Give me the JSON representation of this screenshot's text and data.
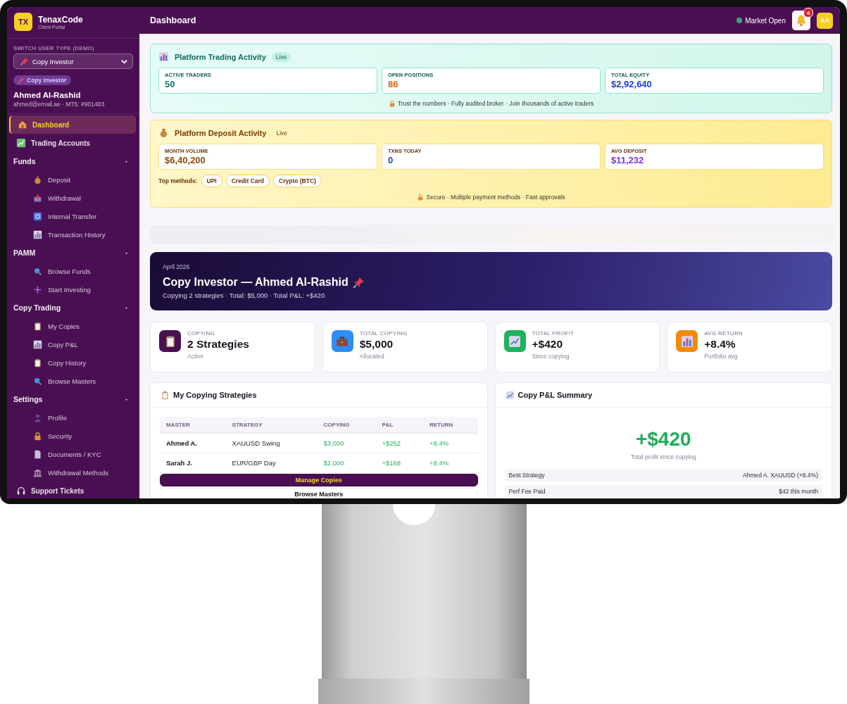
{
  "sidebar": {
    "logo": "TX",
    "brand": "TenaxCode",
    "brand_subtitle": "Client Portal",
    "switcher": {
      "label": "SWITCH USER TYPE (DEMO)",
      "value": "Copy Investor"
    },
    "role_badge": "Copy Investor",
    "user": {
      "name": "Ahmed Al-Rashid",
      "meta": "ahmed@email.ae · MT5: #901483"
    },
    "nav": [
      {
        "kind": "link",
        "label": "Dashboard",
        "selected": true
      },
      {
        "kind": "link",
        "label": "Trading Accounts",
        "selected": false
      },
      {
        "kind": "group",
        "label": "Funds",
        "expanded": true,
        "children": [
          {
            "label": "Deposit",
            "selected": false
          },
          {
            "label": "Withdrawal",
            "selected": false
          },
          {
            "label": "Internal Transfer",
            "selected": false
          },
          {
            "label": "Transaction History",
            "selected": false
          }
        ]
      },
      {
        "kind": "group",
        "label": "PAMM",
        "expanded": true,
        "children": [
          {
            "label": "Browse Funds",
            "selected": false
          },
          {
            "label": "Start Investing",
            "selected": false
          }
        ]
      },
      {
        "kind": "group",
        "label": "Copy Trading",
        "expanded": true,
        "children": [
          {
            "label": "My Copies",
            "selected": false
          },
          {
            "label": "Copy P&L",
            "selected": false
          },
          {
            "label": "Copy History",
            "selected": false
          },
          {
            "label": "Browse Masters",
            "selected": false
          }
        ]
      },
      {
        "kind": "group",
        "label": "Settings",
        "expanded": true,
        "children": [
          {
            "label": "Profile",
            "selected": false
          },
          {
            "label": "Security",
            "selected": false
          },
          {
            "label": "Documents / KYC",
            "selected": false
          },
          {
            "label": "Withdrawal Methods",
            "selected": false
          }
        ]
      },
      {
        "kind": "link",
        "label": "Support Tickets",
        "selected": false
      }
    ]
  },
  "header": {
    "title": "Dashboard",
    "market_status": {
      "label": "Market Open",
      "open": true
    },
    "notifications": "4",
    "avatar": "AA"
  },
  "activity_panels": [
    {
      "kind": "trading",
      "title": "Platform Trading Activity",
      "badge": "Live",
      "stats": [
        {
          "label": "ACTIVE TRADERS",
          "value": "50",
          "color": "#0f7a6a"
        },
        {
          "label": "OPEN POSITIONS",
          "value": "86",
          "color": "#d9620b"
        },
        {
          "label": "TOTAL EQUITY",
          "value": "$2,92,640",
          "color": "#1d3fc8"
        }
      ],
      "note": "Trust the numbers · Fully audited broker · Join thousands of active traders"
    },
    {
      "kind": "deposit",
      "title": "Platform Deposit Activity",
      "badge": "Live",
      "stats": [
        {
          "label": "MONTH VOLUME",
          "value": "$6,40,200",
          "color": "#8a4b0a"
        },
        {
          "label": "TXNS TODAY",
          "value": "0",
          "color": "#1d3fc8"
        },
        {
          "label": "AVG DEPOSIT",
          "value": "$11,232",
          "color": "#7c2ff0"
        }
      ],
      "methods_label": "Top methods:",
      "methods": [
        "UPI",
        "Credit Card",
        "Crypto (BTC)"
      ],
      "note": "Secure · Multiple payment methods · Fast approvals"
    }
  ],
  "hero": {
    "date": "April 2026",
    "title": "Copy Investor — Ahmed Al-Rashid",
    "subtitle": "Copying 2 strategies · Total: $5,000 · Total P&L: +$420"
  },
  "stat_cards": [
    {
      "label": "COPYING",
      "value": "2 Strategies",
      "sub": "Active",
      "color": "#4a0f52"
    },
    {
      "label": "TOTAL COPYING",
      "value": "$5,000",
      "sub": "Allocated",
      "color": "#2b8ff5"
    },
    {
      "label": "TOTAL PROFIT",
      "value": "+$420",
      "sub": "Since copying",
      "color": "#1fb25a"
    },
    {
      "label": "AVG RETURN",
      "value": "+8.4%",
      "sub": "Portfolio avg",
      "color": "#f58a0a"
    }
  ],
  "strategies": {
    "title": "My Copying Strategies",
    "columns": [
      "MASTER",
      "STRATEGY",
      "COPYING",
      "P&L",
      "RETURN"
    ],
    "rows": [
      [
        "Ahmed A.",
        "XAUUSD Swing",
        "$3,000",
        "+$252",
        "+8.4%"
      ],
      [
        "Sarah J.",
        "EUR/GBP Day",
        "$2,000",
        "+$168",
        "+8.4%"
      ]
    ],
    "buttons": [
      {
        "label": "Manage Copies",
        "kind": "primary"
      },
      {
        "label": "Browse Masters",
        "kind": "secondary"
      }
    ]
  },
  "pnl_summary": {
    "title": "Copy P&L Summary",
    "total": "+$420",
    "caption": "Total profit since copying",
    "rows": [
      {
        "label": "Best Strategy",
        "value": "Ahmed A. XAUUSD (+8.4%)"
      },
      {
        "label": "Perf Fee Paid",
        "value": "$42 this month"
      }
    ]
  }
}
